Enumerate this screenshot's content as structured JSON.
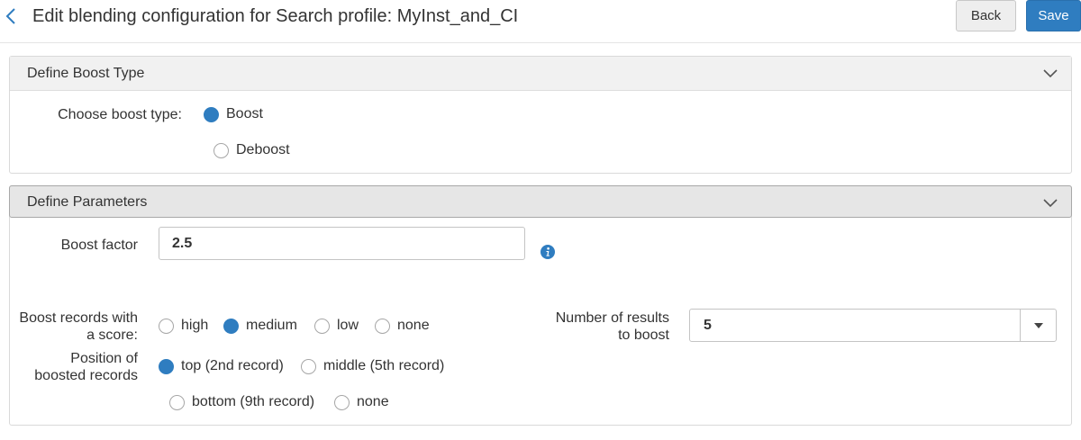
{
  "header": {
    "title": "Edit blending configuration for Search profile: MyInst_and_CI",
    "back_label": "Back",
    "save_label": "Save"
  },
  "boost_type_section": {
    "title": "Define Boost Type",
    "label": "Choose boost type:",
    "options": [
      {
        "label": "Boost",
        "selected": true
      },
      {
        "label": "Deboost",
        "selected": false
      }
    ]
  },
  "parameters_section": {
    "title": "Define Parameters",
    "boost_factor": {
      "label": "Boost factor",
      "value": "2.5"
    },
    "score": {
      "label_line1": "Boost records with",
      "label_line2": "a score:",
      "options": [
        {
          "label": "high",
          "selected": false
        },
        {
          "label": "medium",
          "selected": true
        },
        {
          "label": "low",
          "selected": false
        },
        {
          "label": "none",
          "selected": false
        }
      ]
    },
    "position": {
      "label_line1": "Position of",
      "label_line2": "boosted records",
      "options": [
        {
          "label": "top (2nd record)",
          "selected": true
        },
        {
          "label": "middle (5th record)",
          "selected": false
        },
        {
          "label": "bottom (9th record)",
          "selected": false
        },
        {
          "label": "none",
          "selected": false
        }
      ]
    },
    "num_results": {
      "label_line1": "Number of results",
      "label_line2": "to boost",
      "value": "5"
    }
  },
  "icons": {
    "back": "chevron-left-icon",
    "collapse": "chevron-down-icon",
    "info": "info-icon",
    "dropdown": "caret-down-icon"
  },
  "colors": {
    "primary": "#2f7dc0",
    "text": "#333333"
  }
}
